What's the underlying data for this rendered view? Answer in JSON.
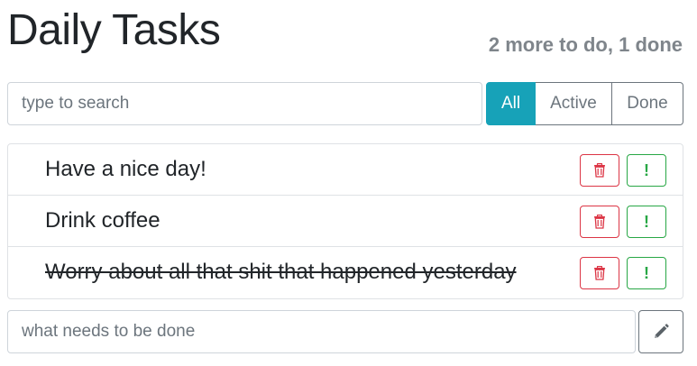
{
  "header": {
    "title": "Daily Tasks",
    "counter": "2 more to do, 1 done"
  },
  "search": {
    "value": "",
    "placeholder": "type to search"
  },
  "filters": [
    {
      "label": "All",
      "active": true
    },
    {
      "label": "Active",
      "active": false
    },
    {
      "label": "Done",
      "active": false
    }
  ],
  "todos": [
    {
      "label": "Have a nice day!",
      "done": false,
      "important": false
    },
    {
      "label": "Drink coffee",
      "done": false,
      "important": false
    },
    {
      "label": "Worry about all that shit that happened yesterday",
      "done": true,
      "important": false
    }
  ],
  "item_actions": {
    "delete_icon": "trash-icon",
    "important_icon": "exclamation-icon",
    "important_glyph": "!"
  },
  "add_form": {
    "value": "",
    "placeholder": "what needs to be done",
    "button_icon": "pencil-icon"
  },
  "colors": {
    "accent": "#17a2b8",
    "danger": "#dc3545",
    "success": "#28a745",
    "muted": "#6c757d"
  }
}
